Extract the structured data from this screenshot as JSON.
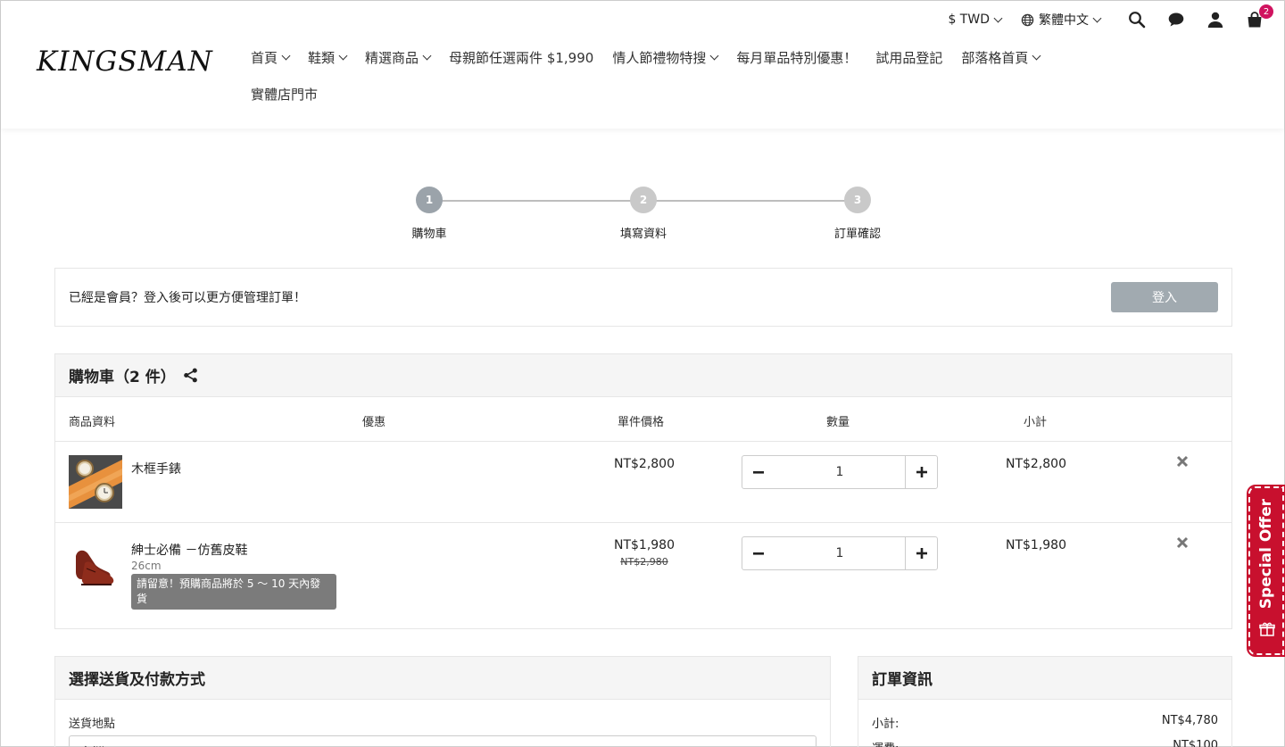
{
  "header": {
    "logo": "KINGSMAN",
    "currency": "$ TWD",
    "language": "繁體中文",
    "cart_count": "2",
    "nav": [
      {
        "label": "首頁",
        "dropdown": true
      },
      {
        "label": "鞋類",
        "dropdown": true
      },
      {
        "label": "精選商品",
        "dropdown": true
      },
      {
        "label": "母親節任選兩件 $1,990",
        "dropdown": false
      },
      {
        "label": "情人節禮物特搜",
        "dropdown": true
      },
      {
        "label": "每月單品特別優惠！",
        "dropdown": false
      },
      {
        "label": "試用品登記",
        "dropdown": false
      },
      {
        "label": "部落格首頁",
        "dropdown": true
      },
      {
        "label": "實體店門市",
        "dropdown": false
      }
    ]
  },
  "steps": [
    {
      "num": "1",
      "label": "購物車",
      "active": true
    },
    {
      "num": "2",
      "label": "填寫資料",
      "active": false
    },
    {
      "num": "3",
      "label": "訂單確認",
      "active": false
    }
  ],
  "member": {
    "message": "已經是會員？登入後可以更方便管理訂單！",
    "login_label": "登入"
  },
  "cart": {
    "title": "購物車（2 件）",
    "columns": {
      "product": "商品資料",
      "discount": "優惠",
      "unit_price": "單件價格",
      "quantity": "數量",
      "subtotal": "小計"
    },
    "items": [
      {
        "name": "木框手錶",
        "variant": "",
        "note": "",
        "price": "NT$2,800",
        "original_price": "",
        "quantity": "1",
        "subtotal": "NT$2,800"
      },
      {
        "name": "紳士必備 －仿舊皮鞋",
        "variant": "26cm",
        "note": "請留意！預購商品將於 5 ～ 10 天內發貨",
        "price": "NT$1,980",
        "original_price": "NT$2,980",
        "quantity": "1",
        "subtotal": "NT$1,980"
      }
    ]
  },
  "shipping": {
    "title": "選擇送貨及付款方式",
    "location_label": "送貨地點",
    "location_value": "台灣"
  },
  "order_info": {
    "title": "訂單資訊",
    "subtotal_label": "小計:",
    "subtotal_value": "NT$4,780",
    "shipping_label": "運費:",
    "shipping_value": "NT$100"
  },
  "special_offer": "Special Offer",
  "colors": {
    "badge": "#d0135f",
    "special_offer": "#c8102e",
    "login_button": "#a1aab0",
    "step_active": "#9ba3aa"
  }
}
